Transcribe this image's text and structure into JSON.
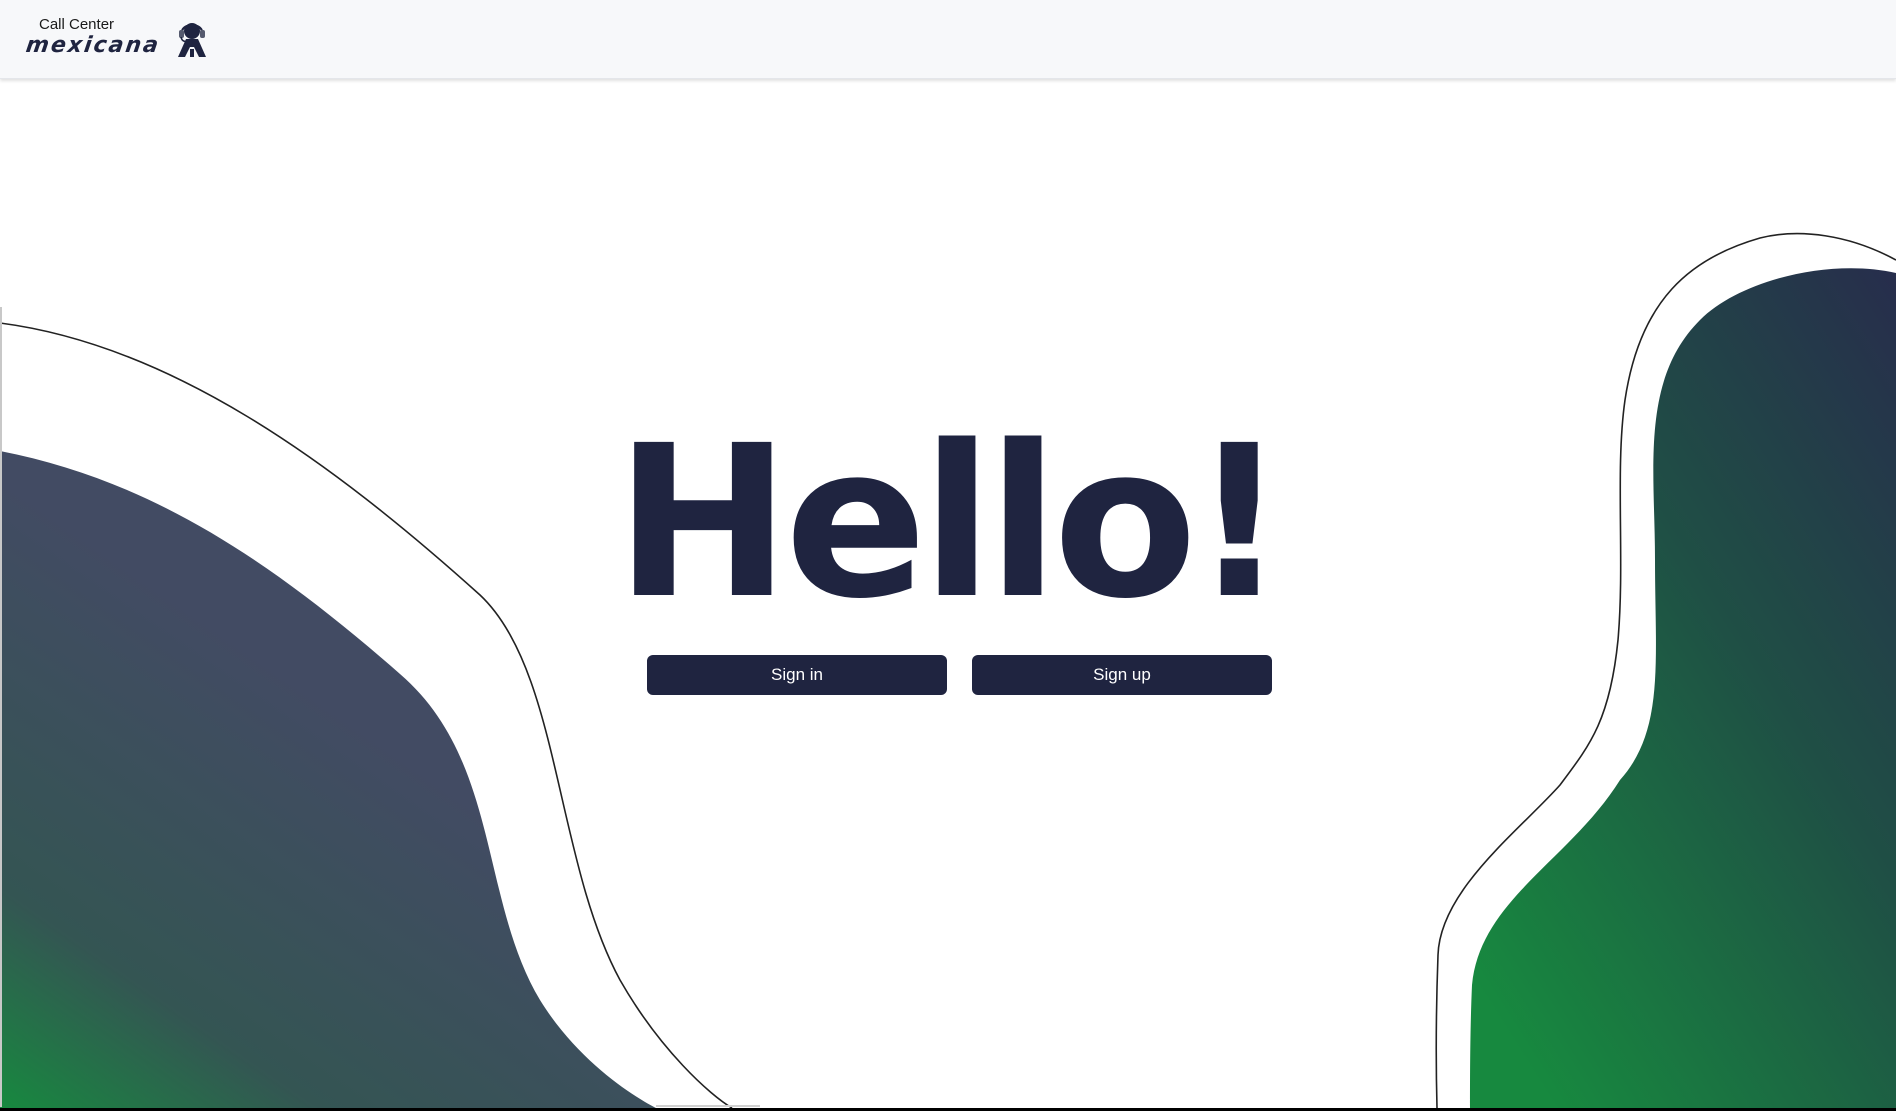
{
  "header": {
    "brand_small": "Call Center",
    "brand_large": "mexicana",
    "logo_icon": "headset-agent-icon"
  },
  "main": {
    "heading": "Hello!",
    "sign_in_label": "Sign in",
    "sign_up_label": "Sign up"
  },
  "colors": {
    "primary": "#1f2440",
    "gradient_dark": "#3f4a63",
    "gradient_green": "#17893f",
    "header_bg": "#f7f8fa"
  }
}
